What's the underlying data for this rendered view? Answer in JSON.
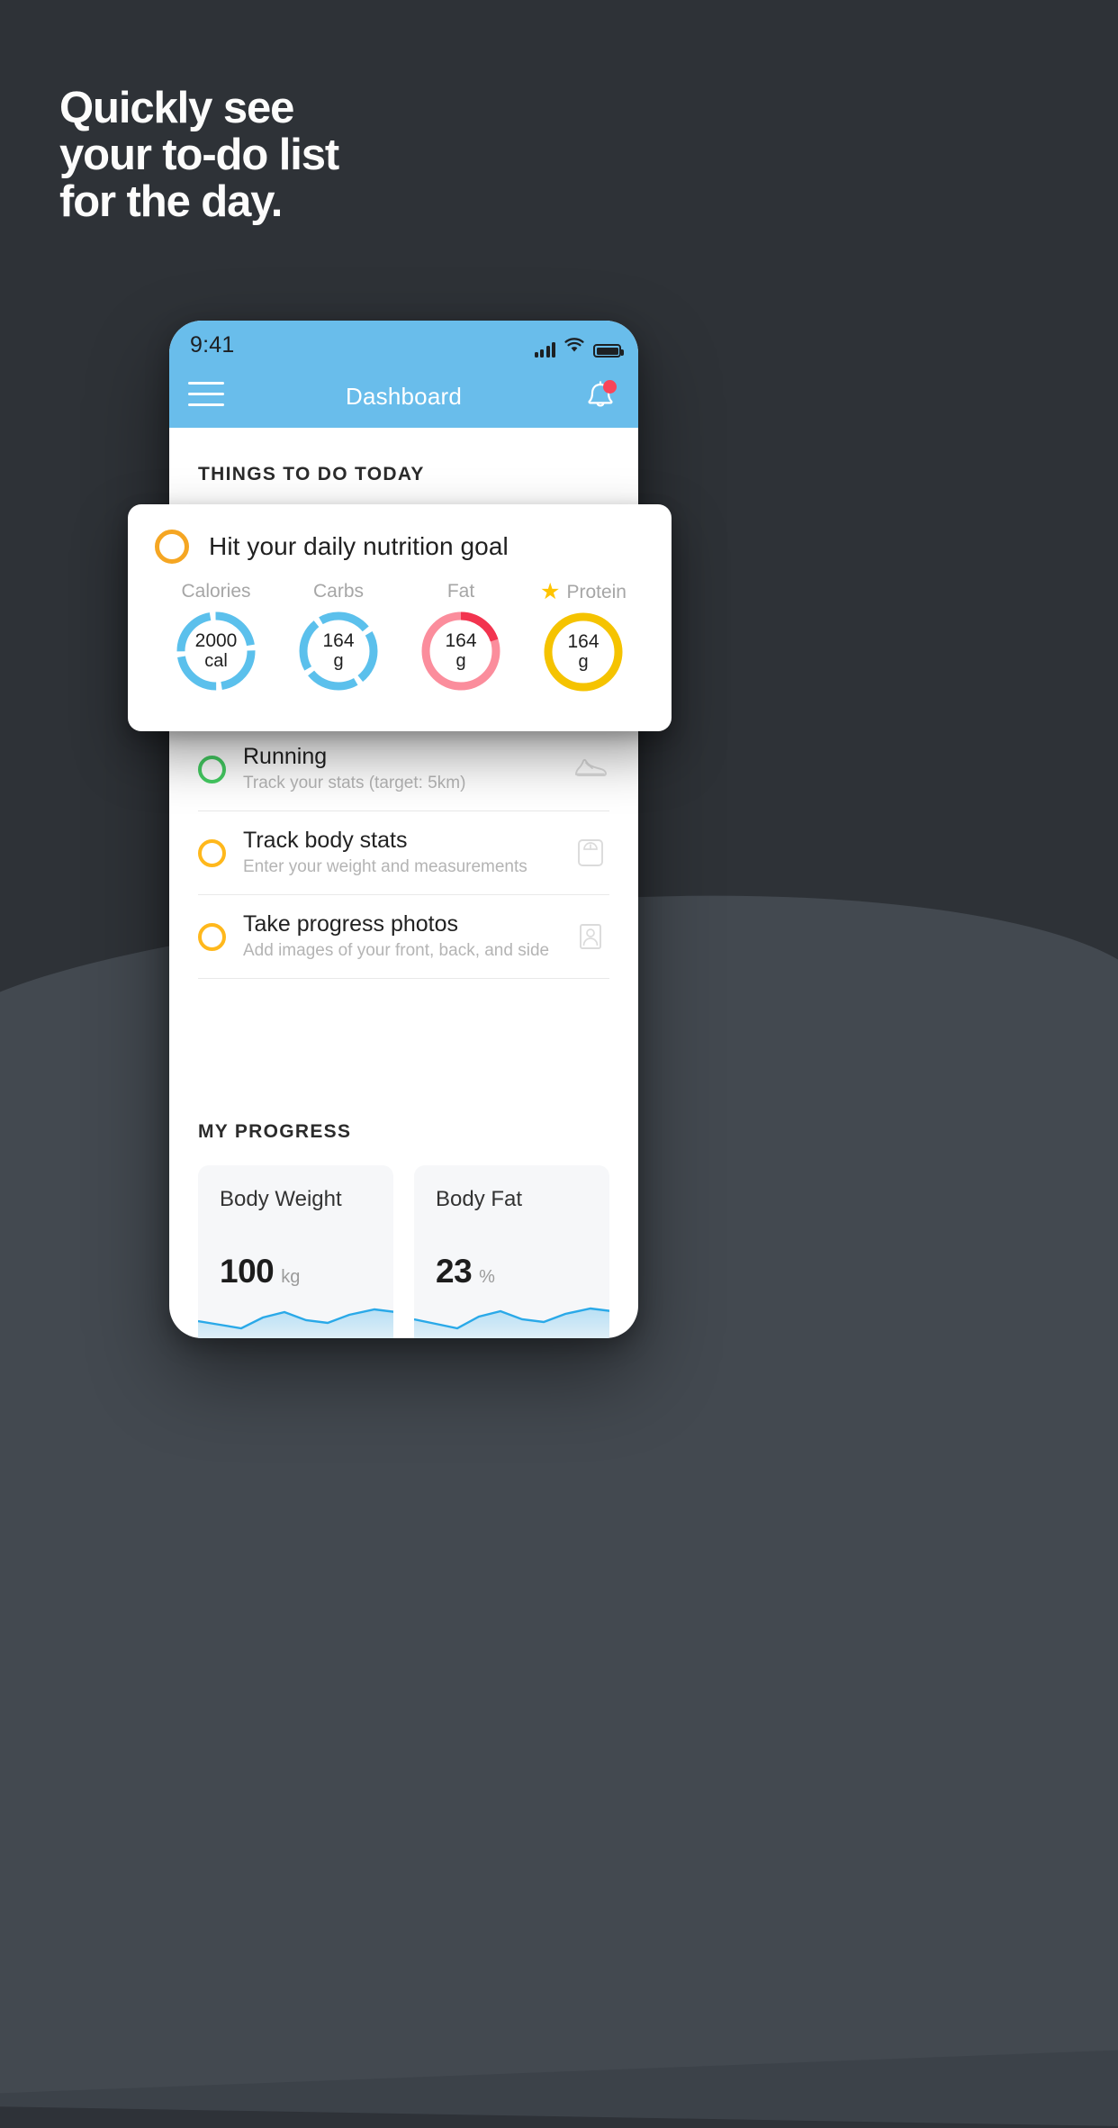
{
  "headline": {
    "lines": [
      "Quickly see",
      "your to-do list",
      "for the day."
    ]
  },
  "colors": {
    "background_dark": "#2e3237",
    "background_light": "#434950",
    "accent_blue": "#69bdeb",
    "yellow": "#ffb81c",
    "green": "#44cc62",
    "red": "#f9455a",
    "pink": "#fb8d9c",
    "gold": "#f5c300"
  },
  "phone": {
    "status_bar": {
      "time": "9:41",
      "icons": [
        "signal-icon",
        "wifi-icon",
        "battery-icon"
      ]
    },
    "app_bar": {
      "menu_icon": "hamburger-icon",
      "title": "Dashboard",
      "notification_icon": "bell-icon",
      "has_badge": true
    },
    "sections": {
      "todo_heading": "THINGS TO DO TODAY",
      "progress_heading": "MY PROGRESS"
    },
    "todos": [
      {
        "title": "Running",
        "subtitle": "Track your stats (target: 5km)",
        "ring_color": "green",
        "icon": "running-shoe-icon"
      },
      {
        "title": "Track body stats",
        "subtitle": "Enter your weight and measurements",
        "ring_color": "yellow",
        "icon": "scale-icon"
      },
      {
        "title": "Take progress photos",
        "subtitle": "Add images of your front, back, and side",
        "ring_color": "yellow",
        "icon": "person-photo-icon"
      }
    ],
    "progress_cards": [
      {
        "title": "Body Weight",
        "value": "100",
        "unit": "kg"
      },
      {
        "title": "Body Fat",
        "value": "23",
        "unit": "%"
      }
    ]
  },
  "nutrition_card": {
    "ring_color": "yellow",
    "title": "Hit your daily nutrition goal",
    "macros": [
      {
        "label": "Calories",
        "value": "2000",
        "unit": "cal",
        "color": "#5bc0ec",
        "starred": false,
        "type": "segmented"
      },
      {
        "label": "Carbs",
        "value": "164",
        "unit": "g",
        "color": "#5bc0ec",
        "starred": false,
        "type": "segmented"
      },
      {
        "label": "Fat",
        "value": "164",
        "unit": "g",
        "color": "#fb8d9c",
        "highlight": "#f2344f",
        "starred": false,
        "type": "arc"
      },
      {
        "label": "Protein",
        "value": "164",
        "unit": "g",
        "color": "#f5c300",
        "starred": true,
        "type": "full"
      }
    ],
    "star_icon": "star-icon"
  },
  "chart_data": [
    {
      "type": "line",
      "title": "Body Weight",
      "ylabel": "kg",
      "values": [
        100,
        98,
        97,
        102,
        104,
        101,
        100,
        103,
        105,
        104
      ],
      "x": [
        1,
        2,
        3,
        4,
        5,
        6,
        7,
        8,
        9,
        10
      ],
      "grid": false,
      "legend": "none"
    },
    {
      "type": "line",
      "title": "Body Fat",
      "ylabel": "%",
      "values": [
        23,
        22,
        21,
        24,
        26,
        24,
        23,
        25,
        27,
        27
      ],
      "x": [
        1,
        2,
        3,
        4,
        5,
        6,
        7,
        8,
        9,
        10
      ],
      "grid": false,
      "legend": "none"
    },
    {
      "type": "pie",
      "title": "Daily nutrition goal",
      "categories": [
        "Calories",
        "Carbs",
        "Fat",
        "Protein"
      ],
      "values": [
        2000,
        164,
        164,
        164
      ],
      "units": [
        "cal",
        "g",
        "g",
        "g"
      ],
      "series": [
        {
          "name": "Calories",
          "value": 2000,
          "unit": "cal",
          "progress_pct": 88,
          "color": "#5bc0ec"
        },
        {
          "name": "Carbs",
          "value": 164,
          "unit": "g",
          "progress_pct": 88,
          "color": "#5bc0ec"
        },
        {
          "name": "Fat",
          "value": 164,
          "unit": "g",
          "progress_pct": 100,
          "highlight_pct": 20,
          "color": "#fb8d9c"
        },
        {
          "name": "Protein",
          "value": 164,
          "unit": "g",
          "progress_pct": 100,
          "color": "#f5c300"
        }
      ],
      "legend": "top"
    }
  ]
}
